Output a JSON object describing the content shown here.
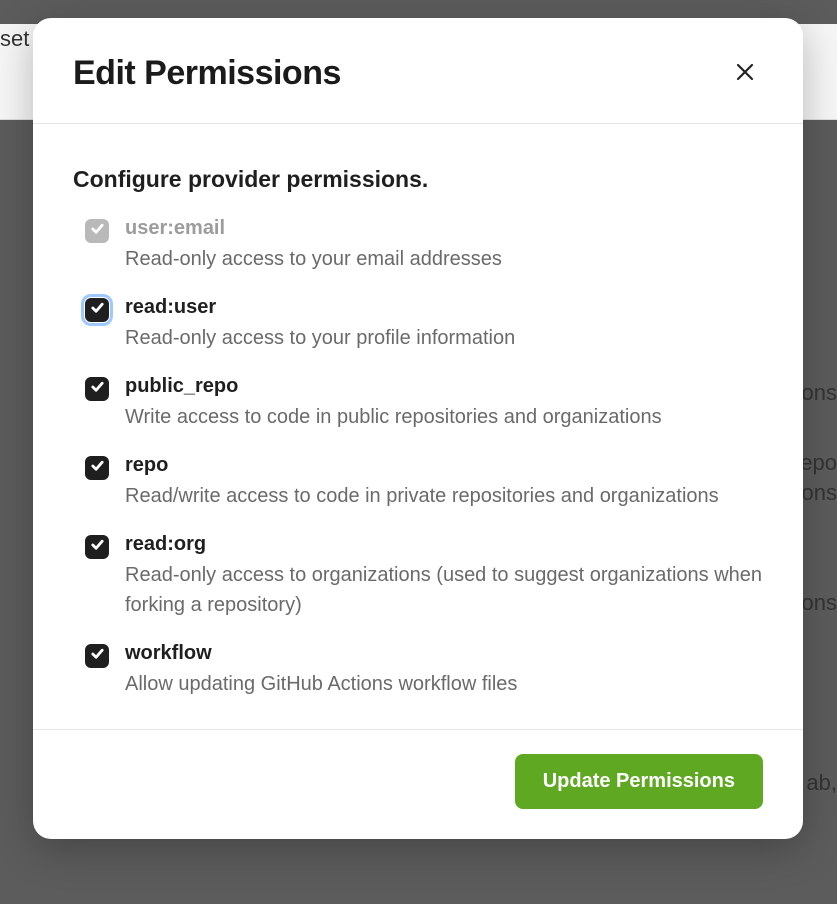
{
  "background": {
    "left_text": "set",
    "right_snippets": [
      "ons",
      "epo",
      "ons",
      "ons",
      "ab,"
    ]
  },
  "modal": {
    "title": "Edit Permissions",
    "subtitle": "Configure provider permissions.",
    "permissions": [
      {
        "key": "user-email",
        "label": "user:email",
        "description": "Read-only access to your email addresses",
        "checked": true,
        "disabled": true,
        "focused": false
      },
      {
        "key": "read-user",
        "label": "read:user",
        "description": "Read-only access to your profile information",
        "checked": true,
        "disabled": false,
        "focused": true
      },
      {
        "key": "public-repo",
        "label": "public_repo",
        "description": "Write access to code in public repositories and organizations",
        "checked": true,
        "disabled": false,
        "focused": false
      },
      {
        "key": "repo",
        "label": "repo",
        "description": "Read/write access to code in private repositories and organizations",
        "checked": true,
        "disabled": false,
        "focused": false
      },
      {
        "key": "read-org",
        "label": "read:org",
        "description": "Read-only access to organizations (used to suggest organizations when forking a repository)",
        "checked": true,
        "disabled": false,
        "focused": false
      },
      {
        "key": "workflow",
        "label": "workflow",
        "description": "Allow updating GitHub Actions workflow files",
        "checked": true,
        "disabled": false,
        "focused": false
      }
    ],
    "submit_label": "Update Permissions"
  }
}
